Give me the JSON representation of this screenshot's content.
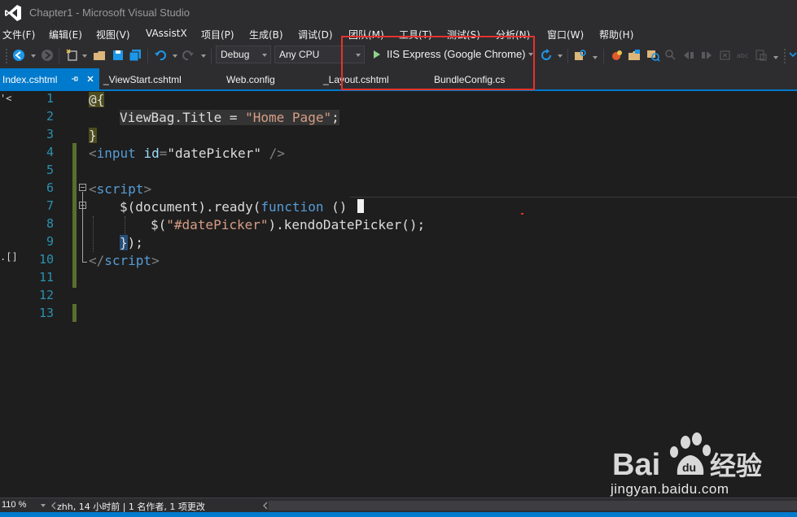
{
  "window": {
    "title": "Chapter1 - Microsoft Visual Studio"
  },
  "menu": {
    "items": [
      "文件(F)",
      "编辑(E)",
      "视图(V)",
      "VAssistX",
      "项目(P)",
      "生成(B)",
      "调试(D)",
      "团队(M)",
      "工具(T)",
      "测试(S)",
      "分析(N)",
      "窗口(W)",
      "帮助(H)"
    ]
  },
  "toolbar": {
    "configuration": "Debug",
    "platform": "Any CPU",
    "run_target": "IIS Express (Google Chrome)"
  },
  "tabs": [
    {
      "label": "Index.cshtml",
      "active": true
    },
    {
      "label": "_ViewStart.cshtml",
      "active": false
    },
    {
      "label": "Web.config",
      "active": false
    },
    {
      "label": "_Layout.cshtml",
      "active": false
    },
    {
      "label": "BundleConfig.cs",
      "active": false
    }
  ],
  "editor": {
    "line_numbers": [
      "1",
      "2",
      "3",
      "4",
      "5",
      "6",
      "7",
      "8",
      "9",
      "10",
      "11",
      "12",
      "13"
    ],
    "margin_glyphs": [
      "'<",
      ".[]"
    ],
    "lines": {
      "l1_razor": "@{",
      "l2_viewbag": "ViewBag.Title = ",
      "l2_string": "\"Home Page\"",
      "l2_semi": ";",
      "l3_brace": "}",
      "l4_open": "<",
      "l4_tag": "input",
      "l4_attr": " id",
      "l4_eq": "=",
      "l4_val": "\"datePicker\"",
      "l4_close": " />",
      "l6_open": "<",
      "l6_tag": "script",
      "l6_close": ">",
      "l7_a": "$(document).ready(",
      "l7_kw": "function",
      "l7_b": " ()",
      "l8_a": "$(",
      "l8_str": "\"#datePicker\"",
      "l8_b": ").kendoDatePicker();",
      "l9_brace": "}",
      "l9_rest": ");",
      "l10_open": "</",
      "l10_tag": "script",
      "l10_close": ">"
    }
  },
  "status": {
    "zoom": "110 %",
    "codelens": "zhh, 14 小时前 | 1 名作者, 1 项更改"
  },
  "watermark": {
    "text": "jingyan.baidu.com"
  },
  "colors": {
    "accent": "#007acc",
    "highlight": "#e5322d",
    "line_number": "#2b91af",
    "string": "#d69d85",
    "keyword": "#569cd6"
  }
}
